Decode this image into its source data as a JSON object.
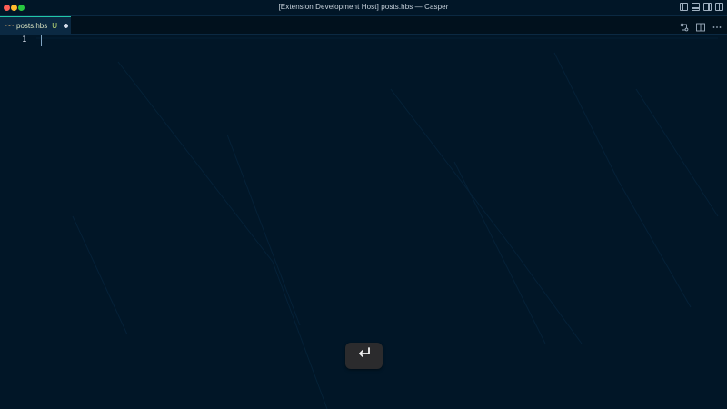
{
  "window": {
    "title": "[Extension Development Host] posts.hbs — Casper"
  },
  "titlebar_icons": [
    "toggle-primary-sidebar-icon",
    "toggle-panel-icon",
    "toggle-secondary-sidebar-icon",
    "customize-layout-icon"
  ],
  "tab": {
    "name": "posts.hbs",
    "status": "U",
    "dirty": true,
    "icon": "handlebars-file-icon"
  },
  "tab_actions": [
    "open-changes-icon",
    "split-editor-icon",
    "more-actions-icon"
  ],
  "editor": {
    "line_numbers": [
      "1"
    ],
    "content": ""
  },
  "key_overlay": {
    "icon": "return-key-icon"
  },
  "colors": {
    "editor_background": "#011627",
    "tab_active_border": "#21c7a8",
    "line_number": "#d6deeb",
    "status_untracked": "#c5e478"
  }
}
